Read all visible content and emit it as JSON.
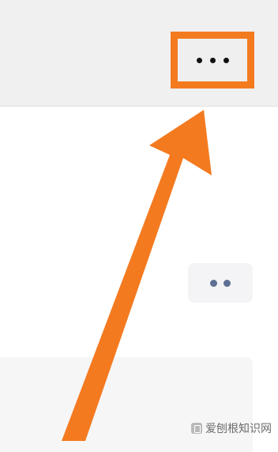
{
  "header": {
    "more_button": {
      "icon": "more-horizontal-icon",
      "highlight_color": "#f47a20"
    }
  },
  "content": {
    "secondary_more_button": {
      "icon": "more-horizontal-icon",
      "dot_color": "#5d6f93"
    }
  },
  "annotation": {
    "arrow_color": "#f47a20"
  },
  "watermark": {
    "text": "爱刨根知识网"
  }
}
